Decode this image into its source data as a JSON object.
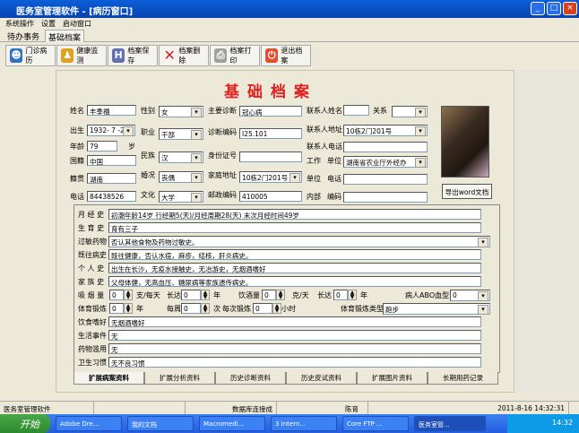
{
  "window": {
    "title": "医务室管理软件 - [病历窗口]",
    "min": "_",
    "max": "□",
    "close": "×"
  },
  "menu": [
    "系统操作",
    "设置",
    "启动窗口"
  ],
  "top_tabs": [
    "待办事务",
    "基础档案"
  ],
  "toolbar": [
    "门诊病历",
    "健康监测",
    "档案保存",
    "档案删除",
    "档案打印",
    "退出档案"
  ],
  "page_title": "基础档案",
  "form": {
    "name_label": "姓名",
    "name": "丰季福",
    "birth_label": "出生",
    "birth": "1932- 7 -25",
    "age_label": "年龄",
    "age": "79",
    "age_unit": "岁",
    "country_label": "国籍",
    "country": "中国",
    "native_label": "籍贯",
    "native": "湖南",
    "phone_label": "电话",
    "phone": "84438526",
    "sex_label": "性别",
    "sex": "女",
    "job_label": "职业",
    "job": "干部",
    "ethnic_label": "民族",
    "ethnic": "汉",
    "marital_label": "婚况",
    "marital": "丧偶",
    "edu_label": "文化",
    "edu": "大学",
    "diag_label": "主要诊断",
    "diag": "冠心病",
    "diagcode_label": "诊断编码",
    "diagcode": "I25.101",
    "id_label": "身份证号",
    "id": "",
    "addr_label": "家庭地址",
    "addr": "10栋2门201号",
    "zip_label": "邮政编码",
    "zip": "410005",
    "cname_label": "联系人姓名",
    "cname": "",
    "rel_label": "关系",
    "rel": "",
    "caddr_label": "联系人地址",
    "caddr": "10栋2门201号",
    "cphone_label": "联系人电话",
    "cphone": "",
    "work_label": "工作",
    "unit_label": "单位",
    "work_unit": "湖南省农业厅外经办",
    "unit2_label": "单位",
    "tel_label": "电话",
    "unit_phone": "",
    "inner_label": "内部",
    "code_label": "编码",
    "inner_code": "",
    "export_button": "导出word文档"
  },
  "history": [
    {
      "label": "月 经 史",
      "value": "初潮年龄14岁 行经期5(天)/月经周期28(天) 末次月经时间49岁"
    },
    {
      "label": "生 育 史",
      "value": "育有三子"
    },
    {
      "label": "过敏药物",
      "value": "否认其他食物及药物过敏史。"
    },
    {
      "label": "既往病史",
      "value": "既往健康，否认水痘，麻疹，结核，肝炎病史。"
    },
    {
      "label": "个 人 史",
      "value": "出生在长沙，无疫水接触史，无冶游史，无烟酒嗜好"
    },
    {
      "label": "家 族 史",
      "value": "父母体健，无高血压、糖尿病等家族遗传病史。"
    }
  ],
  "habits": {
    "smoke_label": "吸 烟 量",
    "smoke": "0",
    "smoke_unit": "支/每天",
    "smoke_years_label": "长达",
    "smoke_years": "0",
    "year_unit": "年",
    "drink_label": "饮酒量",
    "drink": "0",
    "drink_unit": "克/天",
    "drink_years_label": "长达",
    "drink_years": "0",
    "abo_label": "病人ABO血型",
    "abo": "0",
    "ex_label": "体育锻炼",
    "ex_years": "0",
    "weekly_label": "每周",
    "weekly": "0",
    "times_unit": "次",
    "per_label": "每次锻炼",
    "per": "0",
    "hour_unit": "小时",
    "ex_type_label": "体育锻炼类型",
    "ex_type": "跑步"
  },
  "history2": [
    {
      "label": "饮食嗜好",
      "value": "无烟酒嗜好"
    },
    {
      "label": "生活事件",
      "value": "无"
    },
    {
      "label": "药物滥用",
      "value": "无"
    },
    {
      "label": "卫生习惯",
      "value": "无不良习惯"
    }
  ],
  "bottom_tabs": [
    "扩展病案资料",
    "扩展分析资料",
    "历史诊断资料",
    "历史皮试资料",
    "扩展图片资料",
    "长期用药记录"
  ],
  "status": {
    "app": "医务室管理软件",
    "db": "数据库连接成功",
    "user": "陈育群",
    "datetime": "2011-8-16 14:32:31"
  },
  "taskbar": {
    "start": "开始",
    "tasks": [
      "Adobe Dre...",
      "我的文档",
      "Macromedi...",
      "3 Intern...",
      "Core FTP ...",
      "医务室管..."
    ],
    "clock": "14:32"
  }
}
